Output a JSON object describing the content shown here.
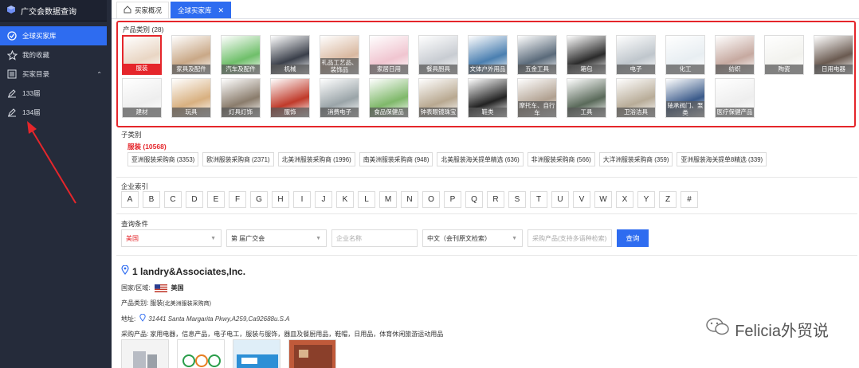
{
  "sidebar": {
    "title": "广交会数据查询",
    "items": [
      {
        "label": "全球买家库",
        "icon": "check-circle-icon"
      },
      {
        "label": "我的收藏",
        "icon": "star-icon"
      },
      {
        "label": "买家目录",
        "icon": "list-icon"
      },
      {
        "label": "133届",
        "icon": "edit-icon"
      },
      {
        "label": "134届",
        "icon": "edit-icon"
      }
    ]
  },
  "tabs": [
    {
      "label": "买家概况",
      "icon": "home-icon"
    },
    {
      "label": "全球买家库"
    }
  ],
  "categories": {
    "label": "产品类别 (28)",
    "items": [
      "服装",
      "家具及配件",
      "汽车及配件",
      "机械",
      "礼品工艺品、装饰品",
      "家居日用",
      "餐具厨具",
      "文体户外用品",
      "五金工具",
      "箱包",
      "电子",
      "化工",
      "纺织",
      "陶瓷",
      "日用电器",
      "建材",
      "玩具",
      "灯具灯饰",
      "服饰",
      "消费电子",
      "食品保健品",
      "钟表眼镜珠宝",
      "鞋类",
      "摩托车、自行车",
      "工具",
      "卫浴洁具",
      "轴承阀门、泵类",
      "医疗保健产品"
    ]
  },
  "subcategory": {
    "label": "子类别",
    "selected": "服装 (10568)",
    "chips": [
      "亚洲服装采购商 (3353)",
      "欧洲服装采购商 (2371)",
      "北美洲服装采购商 (1996)",
      "南美洲服装采购商 (948)",
      "北美服装海关提单精选 (636)",
      "非洲服装采购商 (566)",
      "大洋洲服装采购商 (359)",
      "亚洲服装海关提单8精选 (339)"
    ]
  },
  "company_index": {
    "label": "企业索引",
    "letters": [
      "A",
      "B",
      "C",
      "D",
      "E",
      "F",
      "G",
      "H",
      "I",
      "J",
      "K",
      "L",
      "M",
      "N",
      "O",
      "P",
      "Q",
      "R",
      "S",
      "T",
      "U",
      "V",
      "W",
      "X",
      "Y",
      "Z",
      "#"
    ]
  },
  "query": {
    "label": "查询条件",
    "country": "美国",
    "session": "第   届广交会",
    "company_placeholder": "企业名称",
    "language": "中文（会刊原文检索）",
    "product_placeholder": "采购产品(支持多语种检索)",
    "search_button": "查询"
  },
  "result": {
    "name": "1 landry&Associates,Inc.",
    "country_label": "国家/区域:",
    "country": "美国",
    "category_label": "产品类别:",
    "category": "服装",
    "category_sub": "(北美洲服装采购商)",
    "address_label": "地址:",
    "address": "31441 Santa Margarita Pkwy,A259,Ca92688u.S.A",
    "products_label": "采购产品:",
    "products": "家用电器，信息产品，电子电工，服装与服饰，器皿及餐厨用品，鞋帽，日用品，体育休闲旅游运动用品"
  },
  "watermark": "Felicia外贸说",
  "colors": {
    "accent": "#2e6cf0",
    "highlight": "#e5262b",
    "sidebar": "#252b3a"
  }
}
